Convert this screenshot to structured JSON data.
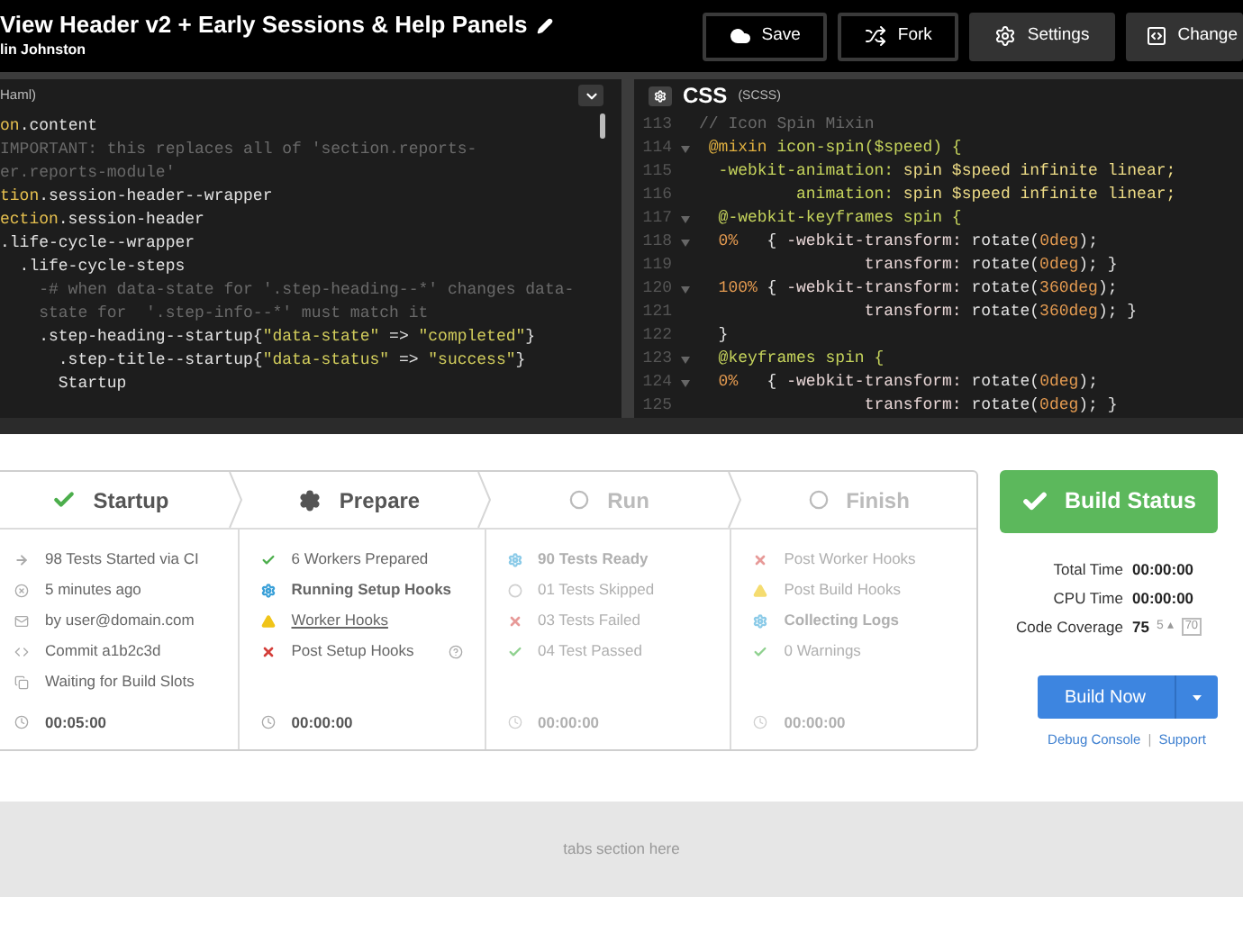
{
  "window": {
    "title": "View Header v2 + Early Sessions & Help Panels",
    "author": "lin Johnston"
  },
  "toolbar": [
    {
      "label": "Save",
      "kind": "outline"
    },
    {
      "label": "Fork",
      "kind": "outline"
    },
    {
      "label": "Settings",
      "kind": "solid"
    },
    {
      "label": "Change",
      "kind": "solid"
    }
  ],
  "editors": {
    "left": {
      "label": "Haml)",
      "lines": [
        [
          {
            "kind": "tag",
            "text": "on"
          },
          {
            "kind": "cls",
            "text": ".content"
          }
        ],
        [
          {
            "kind": "comment",
            "text": "IMPORTANT: this replaces all of 'section.reports-"
          }
        ],
        [
          {
            "kind": "comment",
            "text": "er.reports-module'"
          }
        ],
        [
          {
            "kind": "tag",
            "text": "tion"
          },
          {
            "kind": "cls",
            "text": ".session-header--wrapper"
          }
        ],
        [
          {
            "kind": "tag",
            "text": "ection"
          },
          {
            "kind": "cls",
            "text": ".session-header"
          }
        ],
        [
          {
            "kind": "cls",
            "text": ".life-cycle--wrapper"
          }
        ],
        [
          {
            "kind": "cls",
            "text": "  .life-cycle-steps"
          }
        ],
        [
          {
            "kind": "comment",
            "text": "    -# when data-state for '.step-heading--*' changes data-"
          }
        ],
        [
          {
            "kind": "comment",
            "text": "    state for  '.step-info--*' must match it"
          }
        ],
        [
          {
            "kind": "cls",
            "text": "    .step-heading--startup{"
          },
          {
            "kind": "str",
            "text": "\"data-state\""
          },
          {
            "kind": "cls",
            "text": " => "
          },
          {
            "kind": "str",
            "text": "\"completed\""
          },
          {
            "kind": "cls",
            "text": "}"
          }
        ],
        [
          {
            "kind": "cls",
            "text": "      .step-title--startup{"
          },
          {
            "kind": "str",
            "text": "\"data-status\""
          },
          {
            "kind": "cls",
            "text": " => "
          },
          {
            "kind": "str",
            "text": "\"success\""
          },
          {
            "kind": "cls",
            "text": "}"
          }
        ],
        [
          {
            "kind": "cls",
            "text": "      Startup"
          }
        ]
      ]
    },
    "right": {
      "title": "CSS",
      "subtitle": "(SCSS)",
      "lines": [
        {
          "n": "113",
          "fold": false,
          "tokens": [
            {
              "kind": "comment",
              "text": "// Icon Spin Mixin"
            }
          ]
        },
        {
          "n": "114",
          "fold": true,
          "tokens": [
            {
              "kind": "at",
              "text": " @mixin"
            },
            {
              "kind": "fn",
              "text": " icon-spin($speed) {"
            }
          ]
        },
        {
          "n": "115",
          "fold": false,
          "tokens": [
            {
              "kind": "fn",
              "text": "  -webkit-animation:"
            },
            {
              "kind": "val",
              "text": " spin $speed infinite linear;"
            }
          ]
        },
        {
          "n": "116",
          "fold": false,
          "tokens": [
            {
              "kind": "fn",
              "text": "          animation:"
            },
            {
              "kind": "val",
              "text": " spin $speed infinite linear;"
            }
          ]
        },
        {
          "n": "117",
          "fold": true,
          "tokens": [
            {
              "kind": "fn",
              "text": "  @-webkit-keyframes spin {"
            }
          ]
        },
        {
          "n": "118",
          "fold": true,
          "tokens": [
            {
              "kind": "num",
              "text": "  0%"
            },
            {
              "kind": "plain",
              "text": "   { "
            },
            {
              "kind": "prop",
              "text": "-webkit-transform:"
            },
            {
              "kind": "plain",
              "text": " rotate("
            },
            {
              "kind": "num",
              "text": "0deg"
            },
            {
              "kind": "plain",
              "text": ");"
            }
          ]
        },
        {
          "n": "119",
          "fold": false,
          "tokens": [
            {
              "kind": "prop",
              "text": "                 transform:"
            },
            {
              "kind": "plain",
              "text": " rotate("
            },
            {
              "kind": "num",
              "text": "0deg"
            },
            {
              "kind": "plain",
              "text": "); }"
            }
          ]
        },
        {
          "n": "120",
          "fold": true,
          "tokens": [
            {
              "kind": "num",
              "text": "  100%"
            },
            {
              "kind": "plain",
              "text": " { "
            },
            {
              "kind": "prop",
              "text": "-webkit-transform:"
            },
            {
              "kind": "plain",
              "text": " rotate("
            },
            {
              "kind": "num",
              "text": "360deg"
            },
            {
              "kind": "plain",
              "text": ");"
            }
          ]
        },
        {
          "n": "121",
          "fold": false,
          "tokens": [
            {
              "kind": "prop",
              "text": "                 transform:"
            },
            {
              "kind": "plain",
              "text": " rotate("
            },
            {
              "kind": "num",
              "text": "360deg"
            },
            {
              "kind": "plain",
              "text": "); }"
            }
          ]
        },
        {
          "n": "122",
          "fold": false,
          "tokens": [
            {
              "kind": "plain",
              "text": "  }"
            }
          ]
        },
        {
          "n": "123",
          "fold": true,
          "tokens": [
            {
              "kind": "fn",
              "text": "  @keyframes spin {"
            }
          ]
        },
        {
          "n": "124",
          "fold": true,
          "tokens": [
            {
              "kind": "num",
              "text": "  0%"
            },
            {
              "kind": "plain",
              "text": "   { "
            },
            {
              "kind": "prop",
              "text": "-webkit-transform:"
            },
            {
              "kind": "plain",
              "text": " rotate("
            },
            {
              "kind": "num",
              "text": "0deg"
            },
            {
              "kind": "plain",
              "text": ");"
            }
          ]
        },
        {
          "n": "125",
          "fold": false,
          "tokens": [
            {
              "kind": "prop",
              "text": "                 transform:"
            },
            {
              "kind": "plain",
              "text": " rotate("
            },
            {
              "kind": "num",
              "text": "0deg"
            },
            {
              "kind": "plain",
              "text": "); }"
            }
          ]
        }
      ]
    }
  },
  "lifecycle": {
    "steps": [
      {
        "title": "Startup",
        "kind": "done",
        "time": "00:05:00",
        "items": [
          {
            "kind": "arrow",
            "text": "98 Tests Started via CI",
            "bold": false,
            "link": false,
            "help": false
          },
          {
            "kind": "clock-x",
            "text": "5 minutes ago",
            "bold": false,
            "link": false,
            "help": false
          },
          {
            "kind": "mail",
            "text": "by user@domain.com",
            "bold": false,
            "link": false,
            "help": false
          },
          {
            "kind": "code",
            "text": "Commit a1b2c3d",
            "bold": false,
            "link": false,
            "help": false
          },
          {
            "kind": "copy",
            "text": "Waiting for Build Slots",
            "bold": false,
            "link": false,
            "help": false
          }
        ]
      },
      {
        "title": "Prepare",
        "kind": "active",
        "time": "00:00:00",
        "items": [
          {
            "kind": "check",
            "text": "6 Workers Prepared",
            "bold": false,
            "link": false,
            "help": false
          },
          {
            "kind": "gear",
            "text": "Running Setup Hooks",
            "bold": true,
            "link": false,
            "help": false
          },
          {
            "kind": "warning",
            "text": "Worker Hooks",
            "bold": false,
            "link": true,
            "help": false
          },
          {
            "kind": "cross",
            "text": "Post Setup Hooks",
            "bold": false,
            "link": false,
            "help": true
          }
        ]
      },
      {
        "title": "Run",
        "kind": "pending",
        "time": "00:00:00",
        "items": [
          {
            "kind": "gear",
            "text": "90 Tests Ready",
            "bold": true,
            "link": false,
            "help": false
          },
          {
            "kind": "circle",
            "text": "01 Tests Skipped",
            "bold": false,
            "link": false,
            "help": false
          },
          {
            "kind": "cross",
            "text": "03 Tests Failed",
            "bold": false,
            "link": false,
            "help": false
          },
          {
            "kind": "check",
            "text": "04 Test Passed",
            "bold": false,
            "link": false,
            "help": false
          }
        ]
      },
      {
        "title": "Finish",
        "kind": "pending",
        "time": "00:00:00",
        "items": [
          {
            "kind": "cross",
            "text": "Post Worker Hooks",
            "bold": false,
            "link": false,
            "help": false
          },
          {
            "kind": "warning",
            "text": "Post Build Hooks",
            "bold": false,
            "link": false,
            "help": false
          },
          {
            "kind": "gear",
            "text": "Collecting Logs",
            "bold": true,
            "link": false,
            "help": false
          },
          {
            "kind": "check",
            "text": "0 Warnings",
            "bold": false,
            "link": false,
            "help": false
          }
        ]
      }
    ]
  },
  "build": {
    "status": "Build Status",
    "stats": [
      {
        "label": "Total Time",
        "value": "00:00:00"
      },
      {
        "label": "CPU Time",
        "value": "00:00:00"
      },
      {
        "label": "Code Coverage",
        "value": "75",
        "delta": "5 ▴",
        "threshold": "70"
      }
    ],
    "primary": "Build Now",
    "links": [
      "Debug Console",
      "Support"
    ],
    "separator": "|"
  },
  "tabs_placeholder": "tabs section here"
}
